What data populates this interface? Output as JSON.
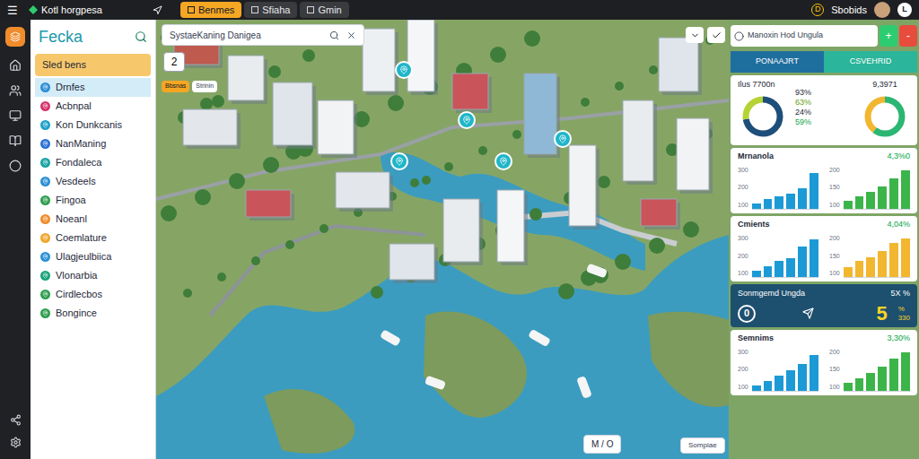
{
  "window": {
    "title": "Kotl horgpesa",
    "menu_icon": "☰"
  },
  "tabs": [
    {
      "label": "Benmes",
      "selected": true
    },
    {
      "label": "Sfiaha",
      "selected": false
    },
    {
      "label": "Gmin",
      "selected": false
    }
  ],
  "account": {
    "badge": "D",
    "name": "Sbobids",
    "avatar_letter": "L"
  },
  "sidebar": {
    "title": "Fecka",
    "section": "Sled bens",
    "items": [
      {
        "label": "Drnfes",
        "selected": true,
        "color": "#2b8fd6"
      },
      {
        "label": "Acbnpal",
        "selected": false,
        "color": "#d6336c"
      },
      {
        "label": "Kon Dunkcanis",
        "selected": false,
        "color": "#1ba1c9"
      },
      {
        "label": "NanManing",
        "selected": false,
        "color": "#2b6fd6"
      },
      {
        "label": "Fondaleca",
        "selected": false,
        "color": "#16a3a3"
      },
      {
        "label": "Vesdeels",
        "selected": false,
        "color": "#2b8fd6"
      },
      {
        "label": "Fingoa",
        "selected": false,
        "color": "#2e9e4f"
      },
      {
        "label": "Noeanl",
        "selected": false,
        "color": "#f08c2b"
      },
      {
        "label": "Coemlature",
        "selected": false,
        "color": "#f0a52b"
      },
      {
        "label": "Ulagjeulbiica",
        "selected": false,
        "color": "#2b8fd6"
      },
      {
        "label": "Vlonarbia",
        "selected": false,
        "color": "#16a37a"
      },
      {
        "label": "Cirdlecbos",
        "selected": false,
        "color": "#2e9e4f"
      },
      {
        "label": "Bongince",
        "selected": false,
        "color": "#2e9e4f"
      }
    ]
  },
  "map": {
    "search": {
      "value": "SystaeKaning Danigea"
    },
    "zoom_label": "2",
    "chips": [
      {
        "label": "Bbsnas",
        "selected": true
      },
      {
        "label": "Strinin",
        "selected": false
      }
    ],
    "bottom_control": "M / O",
    "compare_button": "Sompiae"
  },
  "layer_field": {
    "value": "Manoxin Hod Ungula",
    "plus": "+",
    "minus": "-"
  },
  "panel": {
    "tabs": [
      {
        "label": "PONAAJRT",
        "selected": true
      },
      {
        "label": "CSVEHRID",
        "selected": false
      }
    ],
    "summary": {
      "title": "Ilus 7700n",
      "total": "9,3971",
      "stats": [
        {
          "text": "93%",
          "color": "#1f2937"
        },
        {
          "text": "63%",
          "color": "#65a30d"
        },
        {
          "text": "24%",
          "color": "#1f2937"
        },
        {
          "text": "59%",
          "color": "#16a34a"
        }
      ],
      "donuts": [
        {
          "segments": [
            {
              "color": "#1e4f7a",
              "level": 0.72
            },
            {
              "color": "#b5d334",
              "level": 0.28
            }
          ]
        },
        {
          "segments": [
            {
              "color": "#2bb673",
              "level": 0.6
            },
            {
              "color": "#f2b630",
              "level": 0.4
            }
          ]
        }
      ]
    },
    "charts": [
      {
        "title": "Mrnanola",
        "value": "4,3%0",
        "plots": [
          {
            "ticks": [
              "300",
              "200",
              "100"
            ],
            "color": "#1c9ad6",
            "values": [
              40,
              70,
              95,
              110,
              150,
              270
            ]
          },
          {
            "ticks": [
              "200",
              "150",
              "100"
            ],
            "color": "#3bb54a",
            "values": [
              40,
              60,
              85,
              110,
              150,
              190
            ]
          }
        ]
      },
      {
        "title": "Cmients",
        "value": "4,04%",
        "plots": [
          {
            "ticks": [
              "300",
              "200",
              "100"
            ],
            "color": "#1c9ad6",
            "values": [
              50,
              80,
              120,
              140,
              230,
              280
            ]
          },
          {
            "ticks": [
              "200",
              "150",
              "100"
            ],
            "color": "#f2b630",
            "values": [
              50,
              80,
              100,
              130,
              170,
              195
            ]
          }
        ]
      },
      {
        "title": "Semnims",
        "value": "3,30%",
        "plots": [
          {
            "ticks": [
              "300",
              "200",
              "100"
            ],
            "color": "#1c9ad6",
            "values": [
              40,
              70,
              110,
              150,
              200,
              270
            ]
          },
          {
            "ticks": [
              "200",
              "150",
              "100"
            ],
            "color": "#3bb54a",
            "values": [
              40,
              60,
              90,
              120,
              160,
              190
            ]
          }
        ]
      }
    ],
    "highlight": {
      "title": "Sonmgemd Ungda",
      "reading": "5X %",
      "zero": "0",
      "big": "5",
      "unit": "%",
      "sub": "330"
    }
  }
}
